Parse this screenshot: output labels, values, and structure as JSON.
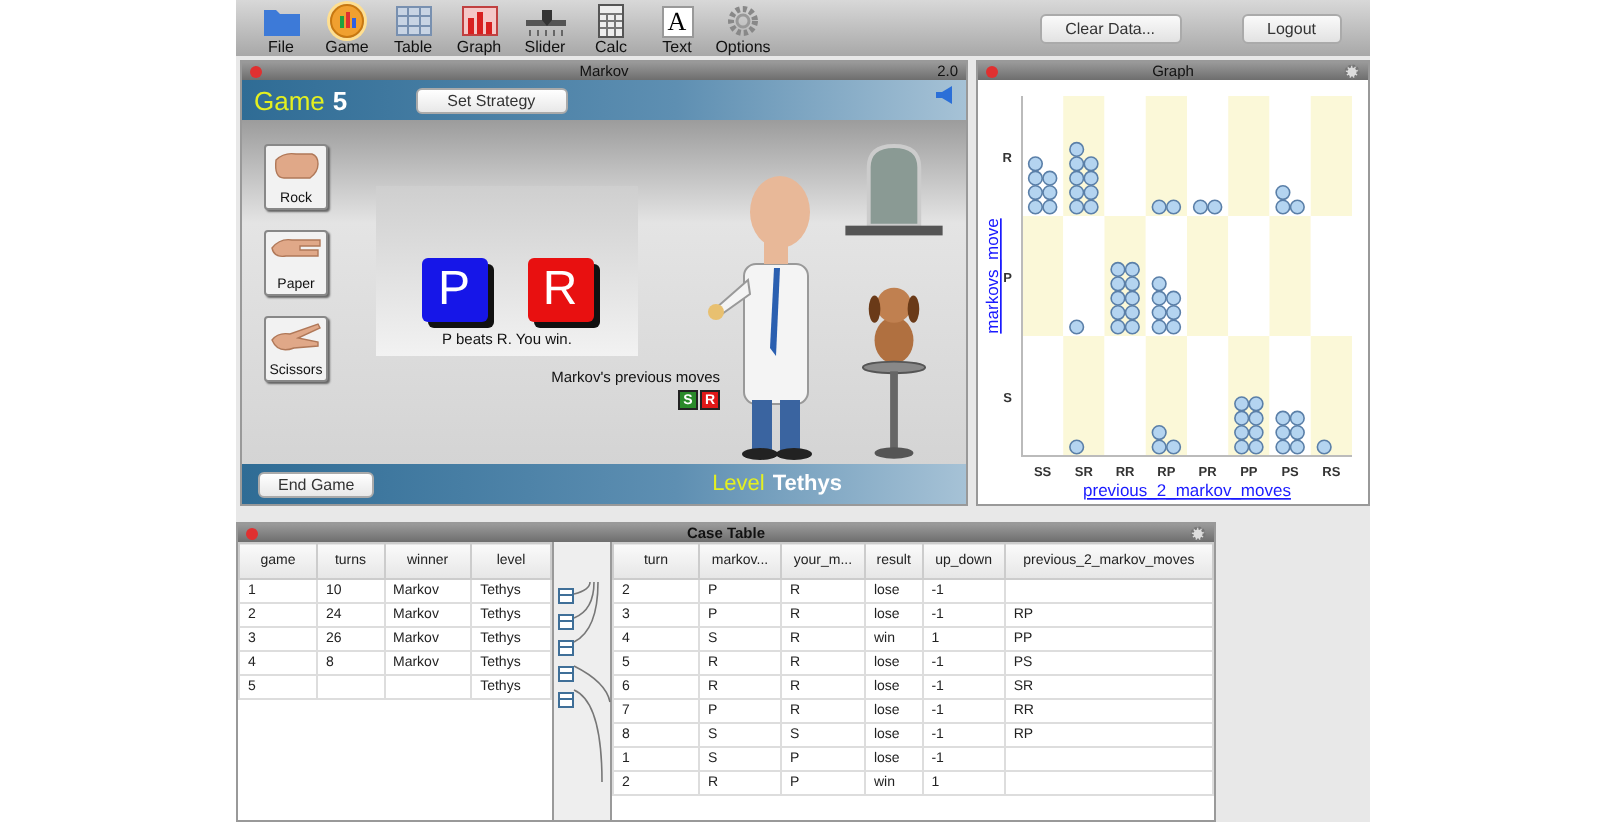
{
  "toolbar": {
    "tools": [
      {
        "kind": "folder",
        "label": "File",
        "selected": false
      },
      {
        "kind": "game",
        "label": "Game",
        "selected": true
      },
      {
        "kind": "table",
        "label": "Table",
        "selected": false
      },
      {
        "kind": "graph",
        "label": "Graph",
        "selected": false
      },
      {
        "kind": "slider",
        "label": "Slider",
        "selected": false
      },
      {
        "kind": "calc",
        "label": "Calc",
        "selected": false
      },
      {
        "kind": "text",
        "label": "Text",
        "glyph": "A",
        "selected": false
      },
      {
        "kind": "options",
        "label": "Options",
        "selected": false
      }
    ],
    "buttons": [
      "Clear Data...",
      "Logout"
    ]
  },
  "markov": {
    "title": "Markov",
    "version": "2.0",
    "game_label": "Game",
    "game_number": "5",
    "set_strategy": "Set Strategy",
    "moves": [
      {
        "kind": "rock",
        "label": "Rock"
      },
      {
        "kind": "paper",
        "label": "Paper"
      },
      {
        "kind": "scissors",
        "label": "Scissors"
      }
    ],
    "player_move": {
      "letter": "P",
      "color": "#1616e8"
    },
    "markov_move": {
      "letter": "R",
      "color": "#e81010"
    },
    "result": "P beats R. You win.",
    "previous_label": "Markov's previous moves",
    "previous_moves": [
      {
        "letter": "S",
        "color": "#2a8a2a"
      },
      {
        "letter": "R",
        "color": "#e01818"
      }
    ],
    "end_game": "End Game",
    "level_label": "Level",
    "level_name": "Tethys"
  },
  "graph": {
    "title": "Graph",
    "x_axis_label": "previous_2_markov_moves",
    "y_axis_label": "markovs_move",
    "x_categories": [
      "SS",
      "SR",
      "RR",
      "RP",
      "PR",
      "PP",
      "PS",
      "RS"
    ],
    "y_categories": [
      "R",
      "P",
      "S"
    ]
  },
  "case_table": {
    "title": "Case Table",
    "games": {
      "columns": [
        "game",
        "turns",
        "winner",
        "level"
      ],
      "rows": [
        [
          "1",
          "10",
          "Markov",
          "Tethys"
        ],
        [
          "2",
          "24",
          "Markov",
          "Tethys"
        ],
        [
          "3",
          "26",
          "Markov",
          "Tethys"
        ],
        [
          "4",
          "8",
          "Markov",
          "Tethys"
        ],
        [
          "5",
          "",
          "",
          "Tethys"
        ]
      ]
    },
    "turns": {
      "columns": [
        "turn",
        "markov...",
        "your_m...",
        "result",
        "up_down",
        "previous_2_markov_moves"
      ],
      "rows": [
        [
          "2",
          "P",
          "R",
          "lose",
          "-1",
          ""
        ],
        [
          "3",
          "P",
          "R",
          "lose",
          "-1",
          "RP"
        ],
        [
          "4",
          "S",
          "R",
          "win",
          "1",
          "PP"
        ],
        [
          "5",
          "R",
          "R",
          "lose",
          "-1",
          "PS"
        ],
        [
          "6",
          "R",
          "R",
          "lose",
          "-1",
          "SR"
        ],
        [
          "7",
          "P",
          "R",
          "lose",
          "-1",
          "RR"
        ],
        [
          "8",
          "S",
          "S",
          "lose",
          "-1",
          "RP"
        ],
        [
          "1",
          "S",
          "P",
          "lose",
          "-1",
          ""
        ],
        [
          "2",
          "R",
          "P",
          "win",
          "1",
          ""
        ]
      ]
    }
  }
}
